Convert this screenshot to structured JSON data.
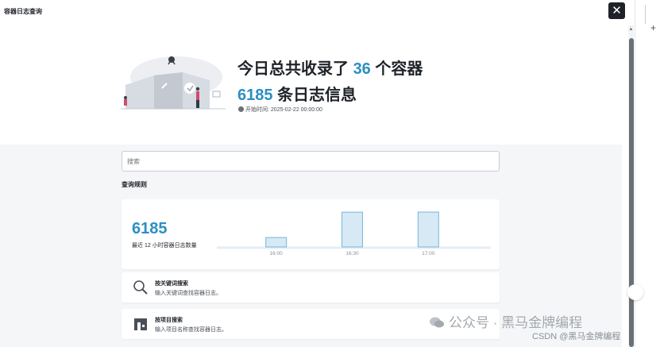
{
  "header": {
    "title": "容器日志查询",
    "close_label": "✕"
  },
  "hero": {
    "line1_prefix": "今日总共收录了",
    "container_count": "36",
    "line1_suffix": "个容器",
    "log_count": "6185",
    "line2_suffix": "条日志信息",
    "start_label": "开始时间:",
    "start_time": "2025-02-22 00:00:00"
  },
  "search": {
    "placeholder": "搜索"
  },
  "rules": {
    "title": "查询规则"
  },
  "stats": {
    "total": "6185",
    "label": "最近 12 小时容器日志数量"
  },
  "chart_data": {
    "type": "bar",
    "categories": [
      "16:00",
      "16:30",
      "17:00"
    ],
    "values": [
      620,
      2280,
      2285
    ],
    "ylim": [
      0,
      2600
    ],
    "grid": false,
    "bar_fill": "#d6e9f5",
    "bar_stroke": "#79b6dc"
  },
  "cards": [
    {
      "title": "按关键词搜索",
      "desc": "输入关键词查找容器日志。",
      "icon": "magnifier-icon"
    },
    {
      "title": "按项目搜索",
      "desc": "输入项目名称查找容器日志。",
      "icon": "project-building-icon"
    }
  ],
  "watermark": {
    "text": "公众号 · 黑马金牌编程",
    "sub": "CSDN @黑马金牌编程"
  },
  "colors": {
    "accent": "#2b8fc3",
    "background": "#f5f6f8",
    "close_bg": "#1f2329"
  }
}
